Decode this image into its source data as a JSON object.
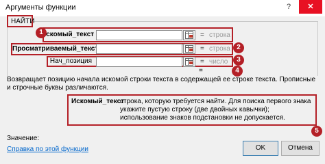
{
  "window": {
    "title": "Аргументы функции",
    "help_glyph": "?",
    "close_glyph": "✕"
  },
  "function_name": "НАЙТИ",
  "arguments": [
    {
      "label": "Искомый_текст",
      "bold": true,
      "value": "",
      "equals": "=",
      "hint": "строка"
    },
    {
      "label": "Просматриваемый_текст",
      "bold": true,
      "value": "",
      "equals": "=",
      "hint": "строка"
    },
    {
      "label": "Нач_позиция",
      "bold": false,
      "value": "",
      "equals": "=",
      "hint": "число"
    }
  ],
  "badges": [
    "1",
    "2",
    "3",
    "4",
    "5"
  ],
  "result_equals": "=",
  "description": "Возвращает позицию начала искомой строки текста в содержащей ее строке текста. Прописные и строчные буквы различаются.",
  "arg_description": {
    "name": "Искомый_текст",
    "text": "строка, которую требуется найти. Для поиска первого знака укажите пустую строку (две двойных кавычки); использование знаков подстановки не допускается."
  },
  "value_label": "Значение:",
  "help_link": "Справка по этой функции",
  "buttons": {
    "ok": "OK",
    "cancel": "Отмена"
  },
  "colors": {
    "annotation": "#b42027",
    "link": "#0066cc",
    "close": "#e81123"
  }
}
